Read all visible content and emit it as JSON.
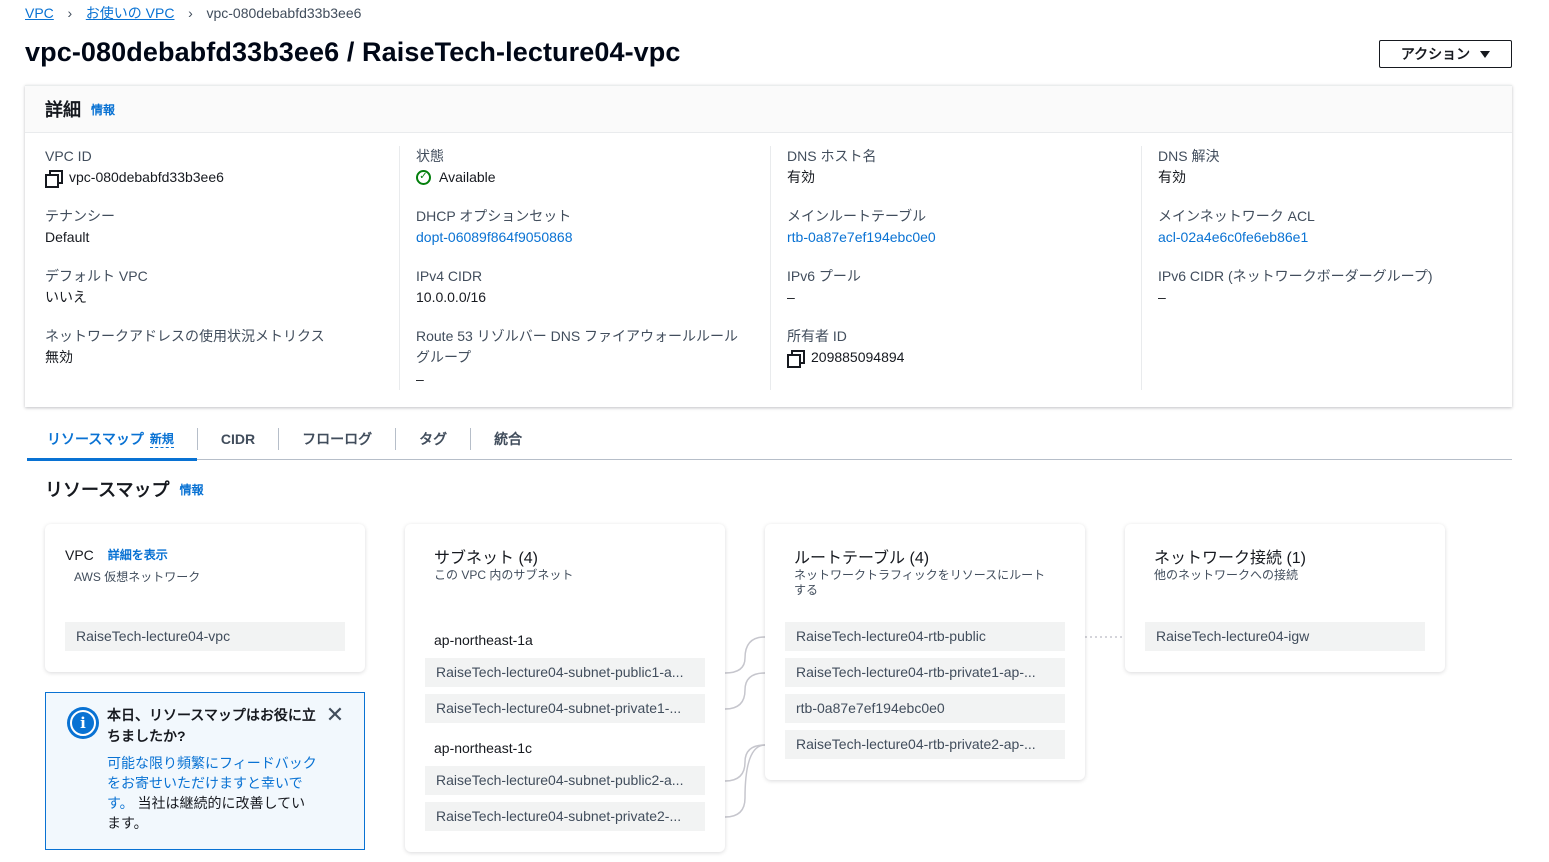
{
  "breadcrumb": {
    "items": [
      "VPC",
      "お使いの VPC"
    ],
    "current": "vpc-080debabfd33b3ee6"
  },
  "title": "vpc-080debabfd33b3ee6 / RaiseTech-lecture04-vpc",
  "actions_label": "アクション",
  "details": {
    "heading": "詳細",
    "info": "情報",
    "col1": [
      {
        "label": "VPC ID",
        "value": "vpc-080debabfd33b3ee6"
      },
      {
        "label": "テナンシー",
        "value": "Default"
      },
      {
        "label": "デフォルト VPC",
        "value": "いいえ"
      },
      {
        "label": "ネットワークアドレスの使用状況メトリクス",
        "value": "無効"
      }
    ],
    "col2": [
      {
        "label": "状態",
        "value": "Available"
      },
      {
        "label": "DHCP オプションセット",
        "value": "dopt-06089f864f9050868"
      },
      {
        "label": "IPv4 CIDR",
        "value": "10.0.0.0/16"
      },
      {
        "label": "Route 53 リゾルバー DNS ファイアウォールルールグループ",
        "value": "–"
      }
    ],
    "col3": [
      {
        "label": "DNS ホスト名",
        "value": "有効"
      },
      {
        "label": "メインルートテーブル",
        "value": "rtb-0a87e7ef194ebc0e0"
      },
      {
        "label": "IPv6 プール",
        "value": "–"
      },
      {
        "label": "所有者 ID",
        "value": "209885094894"
      }
    ],
    "col4": [
      {
        "label": "DNS 解決",
        "value": "有効"
      },
      {
        "label": "メインネットワーク ACL",
        "value": "acl-02a4e6c0fe6eb86e1"
      },
      {
        "label": "IPv6 CIDR (ネットワークボーダーグループ)",
        "value": "–"
      }
    ]
  },
  "tabs": [
    {
      "label": "リソースマップ",
      "badge": "新規"
    },
    {
      "label": "CIDR"
    },
    {
      "label": "フローログ"
    },
    {
      "label": "タグ"
    },
    {
      "label": "統合"
    }
  ],
  "resource_map": {
    "heading": "リソースマップ",
    "info": "情報",
    "vpc": {
      "title": "VPC",
      "details_link": "詳細を表示",
      "subtitle": "AWS 仮想ネットワーク",
      "item": "RaiseTech-lecture04-vpc"
    },
    "subnets": {
      "title": "サブネット (4)",
      "subtitle": "この VPC 内のサブネット",
      "az1": "ap-northeast-1a",
      "az1_items": [
        "RaiseTech-lecture04-subnet-public1-a...",
        "RaiseTech-lecture04-subnet-private1-..."
      ],
      "az2": "ap-northeast-1c",
      "az2_items": [
        "RaiseTech-lecture04-subnet-public2-a...",
        "RaiseTech-lecture04-subnet-private2-..."
      ]
    },
    "route_tables": {
      "title": "ルートテーブル (4)",
      "subtitle": "ネットワークトラフィックをリソースにルートする",
      "items": [
        "RaiseTech-lecture04-rtb-public",
        "RaiseTech-lecture04-rtb-private1-ap-...",
        "rtb-0a87e7ef194ebc0e0",
        "RaiseTech-lecture04-rtb-private2-ap-..."
      ]
    },
    "network": {
      "title": "ネットワーク接続 (1)",
      "subtitle": "他のネットワークへの接続",
      "item": "RaiseTech-lecture04-igw"
    }
  },
  "feedback": {
    "title": "本日、リソースマップはお役に立ちましたか?",
    "body_link": "可能な限り頻繁にフィードバックをお寄せいただけますと幸いです。",
    "body_text": "当社は継続的に改善しています。",
    "close": "✕"
  },
  "colors": {
    "link": "#0972d3",
    "success": "#037f0c",
    "text": "#16191f"
  }
}
